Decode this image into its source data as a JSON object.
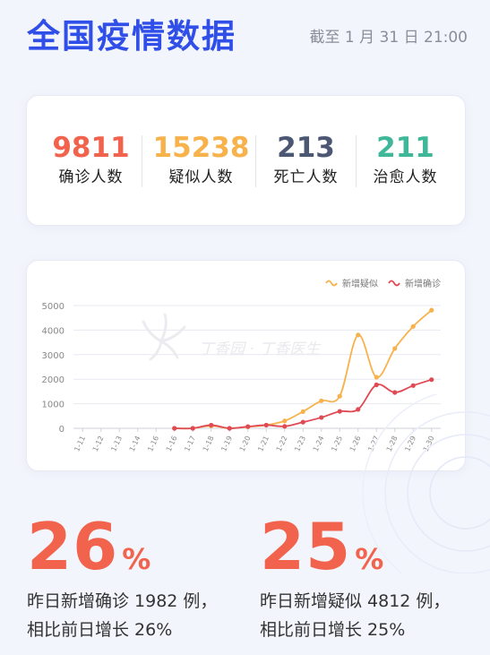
{
  "header": {
    "title": "全国疫情数据",
    "update_time": "截至 1 月 31 日 21:00"
  },
  "stats": [
    {
      "value": "9811",
      "label": "确诊人数",
      "color": "#f2634e"
    },
    {
      "value": "15238",
      "label": "疑似人数",
      "color": "#f7b24c"
    },
    {
      "value": "213",
      "label": "死亡人数",
      "color": "#4c5873"
    },
    {
      "value": "211",
      "label": "治愈人数",
      "color": "#3fb89a"
    }
  ],
  "watermark": "丁香园 · 丁香医生",
  "chart_data": {
    "type": "line",
    "categories": [
      "1-11",
      "1-12",
      "1-13",
      "1-14",
      "1-15",
      "1-16",
      "1-17",
      "1-18",
      "1-19",
      "1-20",
      "1-21",
      "1-22",
      "1-23",
      "1-24",
      "1-25",
      "1-26",
      "1-27",
      "1-28",
      "1-29",
      "1-30"
    ],
    "x_tick_labels": [
      "1-11",
      "1-12",
      "1-13",
      "1-14",
      "1-16",
      "1-16",
      "1-17",
      "1-18",
      "1-19",
      "1-20",
      "1-21",
      "1-22",
      "1-23",
      "1-24",
      "1-25",
      "1-26",
      "1-27",
      "1-28",
      "1-29",
      "1-30"
    ],
    "ylim": [
      0,
      5000
    ],
    "yticks": [
      0,
      1000,
      2000,
      3000,
      4000,
      5000
    ],
    "grid": true,
    "legend": "top-right",
    "series": [
      {
        "name": "新增疑似",
        "color": "#f7b24c",
        "start_index": 5,
        "values": [
          0,
          0,
          100,
          0,
          60,
          130,
          300,
          680,
          1120,
          1310,
          3800,
          2080,
          3250,
          4150,
          4812
        ]
      },
      {
        "name": "新增确诊",
        "color": "#e04a55",
        "start_index": 5,
        "values": [
          0,
          0,
          130,
          0,
          70,
          130,
          80,
          250,
          440,
          690,
          770,
          1770,
          1460,
          1740,
          1982
        ]
      }
    ]
  },
  "summaries": [
    {
      "percent": "26",
      "unit": "%",
      "line1": "昨日新增确诊 1982 例，",
      "line2": "相比前日增长 26%"
    },
    {
      "percent": "25",
      "unit": "%",
      "line1": "昨日新增疑似 4812 例，",
      "line2": "相比前日增长 25%"
    }
  ]
}
